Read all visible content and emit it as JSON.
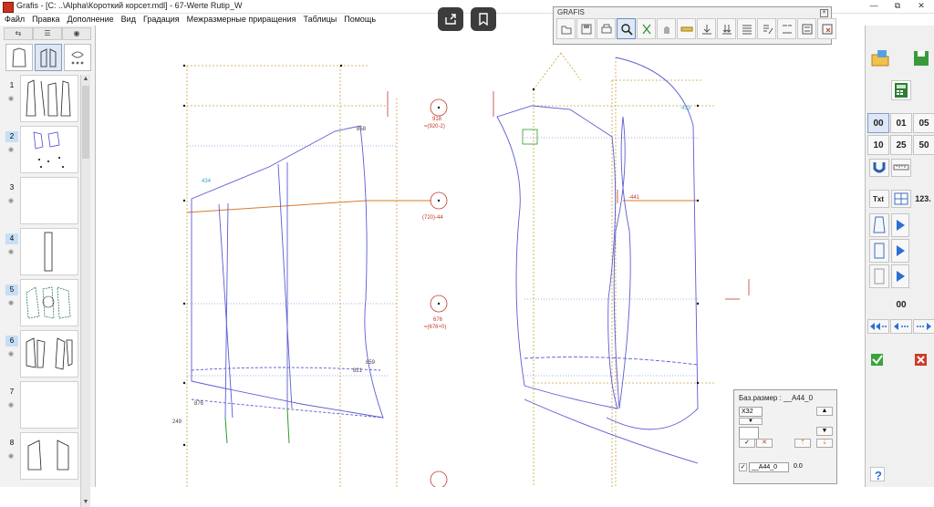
{
  "window": {
    "title": "Grafis - [C: ..\\Alpha\\Короткий корсет.mdl] - 67-Werte Rutip_W",
    "buttons": [
      "—",
      "⧉",
      "✕"
    ]
  },
  "menu": [
    "Файл",
    "Правка",
    "Дополнение",
    "Вид",
    "Градация",
    "Межразмерные приращения",
    "Таблицы",
    "Помощь"
  ],
  "left_panel": {
    "thumbnails": [
      {
        "num": "1",
        "highlighted": false
      },
      {
        "num": "2",
        "highlighted": true
      },
      {
        "num": "3",
        "highlighted": false
      },
      {
        "num": "4",
        "highlighted": true
      },
      {
        "num": "5",
        "highlighted": true
      },
      {
        "num": "6",
        "highlighted": true
      },
      {
        "num": "7",
        "highlighted": false
      },
      {
        "num": "8",
        "highlighted": false
      }
    ]
  },
  "toolbar": {
    "title": "GRAFIS"
  },
  "canvas": {
    "labels": {
      "a858": "858",
      "a434": "434",
      "a433": "433",
      "a918": "918",
      "a918b": "=(920-2)",
      "a720": "(720)-44",
      "a676": "676",
      "a676b": "=(676+0)",
      "a441": "-441",
      "a859": "859",
      "a821": "821",
      "a876": "876",
      "a249": "249"
    },
    "colors": {
      "pattern": "#5b5bd6",
      "construction": "#c8a23c",
      "orange_line": "#d87a2a",
      "red": "#c0392b",
      "cyan": "#3aa6c9",
      "green": "#2e9a2e"
    }
  },
  "right_panel": {
    "grid": [
      "00",
      "01",
      "05",
      "10",
      "25",
      "50"
    ],
    "value_123": "123.",
    "value_00": "00"
  },
  "size_dialog": {
    "title": "Баз.размер :   __A44_0",
    "dropdown": "ХЗ2",
    "row_label": "__A44_0",
    "row_value": "0.0"
  }
}
